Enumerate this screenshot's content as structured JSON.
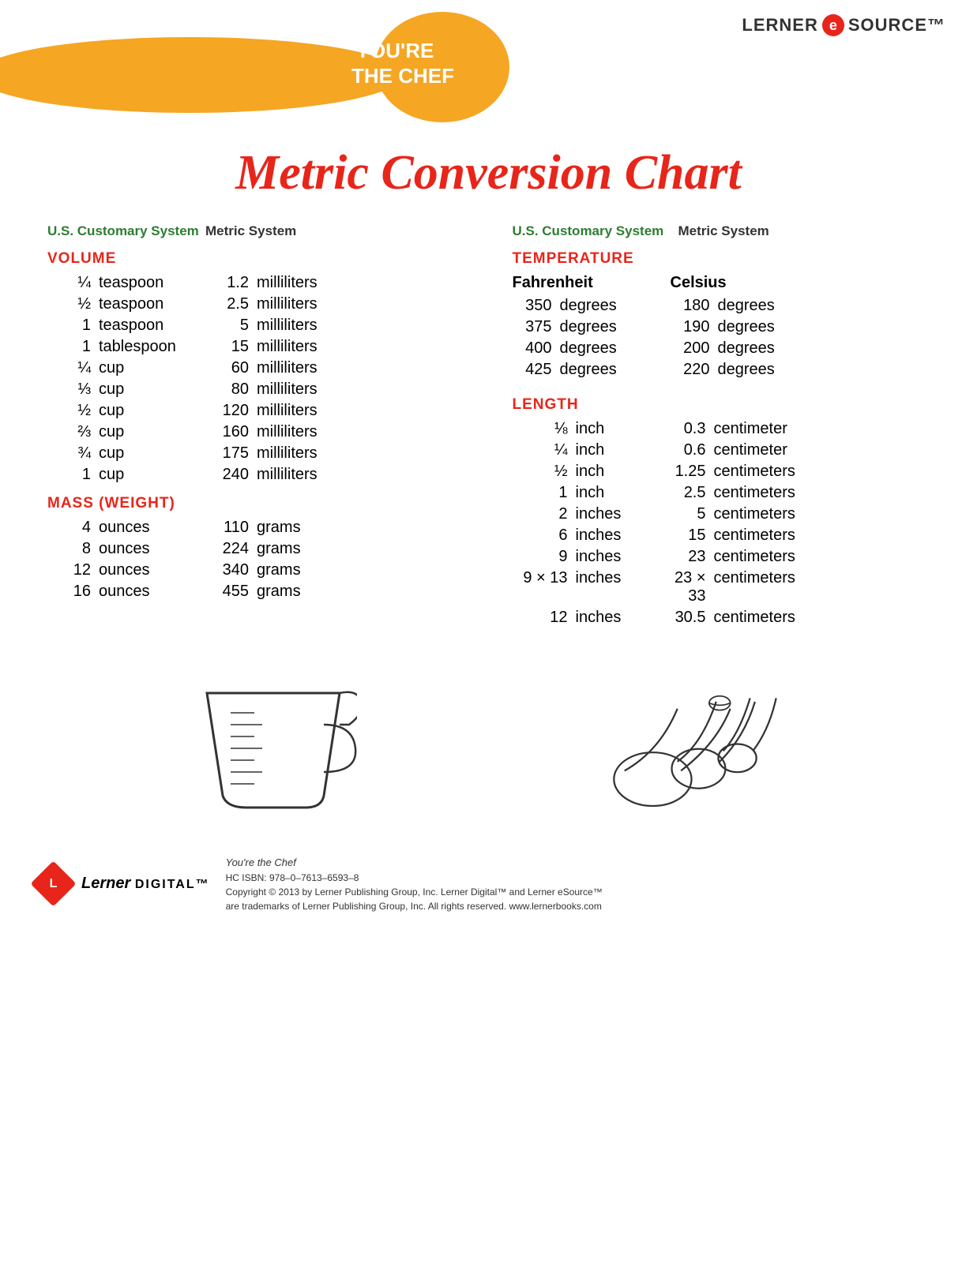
{
  "header": {
    "spoon_text_line1": "YOU'RE",
    "spoon_text_line2": "THE CHEF",
    "lerner_text1": "LERNER",
    "lerner_e": "e",
    "lerner_text2": "SOURCE™"
  },
  "title": "Metric Conversion Chart",
  "left_column": {
    "us_header": "U.S. Customary System",
    "metric_header": "Metric System",
    "volume": {
      "label": "VOLUME",
      "rows": [
        {
          "us_amount": "¼",
          "us_unit": "teaspoon",
          "metric_amount": "1.2",
          "metric_unit": "milliliters"
        },
        {
          "us_amount": "½",
          "us_unit": "teaspoon",
          "metric_amount": "2.5",
          "metric_unit": "milliliters"
        },
        {
          "us_amount": "1",
          "us_unit": "teaspoon",
          "metric_amount": "5",
          "metric_unit": "milliliters"
        },
        {
          "us_amount": "1",
          "us_unit": "tablespoon",
          "metric_amount": "15",
          "metric_unit": "milliliters"
        },
        {
          "us_amount": "¼",
          "us_unit": "cup",
          "metric_amount": "60",
          "metric_unit": "milliliters"
        },
        {
          "us_amount": "⅓",
          "us_unit": "cup",
          "metric_amount": "80",
          "metric_unit": "milliliters"
        },
        {
          "us_amount": "½",
          "us_unit": "cup",
          "metric_amount": "120",
          "metric_unit": "milliliters"
        },
        {
          "us_amount": "⅔",
          "us_unit": "cup",
          "metric_amount": "160",
          "metric_unit": "milliliters"
        },
        {
          "us_amount": "¾",
          "us_unit": "cup",
          "metric_amount": "175",
          "metric_unit": "milliliters"
        },
        {
          "us_amount": "1",
          "us_unit": "cup",
          "metric_amount": "240",
          "metric_unit": "milliliters"
        }
      ]
    },
    "mass": {
      "label": "MASS (WEIGHT)",
      "rows": [
        {
          "us_amount": "4",
          "us_unit": "ounces",
          "metric_amount": "110",
          "metric_unit": "grams"
        },
        {
          "us_amount": "8",
          "us_unit": "ounces",
          "metric_amount": "224",
          "metric_unit": "grams"
        },
        {
          "us_amount": "12",
          "us_unit": "ounces",
          "metric_amount": "340",
          "metric_unit": "grams"
        },
        {
          "us_amount": "16",
          "us_unit": "ounces",
          "metric_amount": "455",
          "metric_unit": "grams"
        }
      ]
    }
  },
  "right_column": {
    "us_header": "U.S. Customary System",
    "metric_header": "Metric System",
    "temperature": {
      "label": "TEMPERATURE",
      "fahrenheit_header": "Fahrenheit",
      "celsius_header": "Celsius",
      "rows": [
        {
          "f_amount": "350",
          "f_unit": "degrees",
          "c_amount": "180",
          "c_unit": "degrees"
        },
        {
          "f_amount": "375",
          "f_unit": "degrees",
          "c_amount": "190",
          "c_unit": "degrees"
        },
        {
          "f_amount": "400",
          "f_unit": "degrees",
          "c_amount": "200",
          "c_unit": "degrees"
        },
        {
          "f_amount": "425",
          "f_unit": "degrees",
          "c_amount": "220",
          "c_unit": "degrees"
        }
      ]
    },
    "length": {
      "label": "LENGTH",
      "rows": [
        {
          "us_amount": "⅛",
          "us_unit": "inch",
          "metric_amount": "0.3",
          "metric_unit": "centimeter"
        },
        {
          "us_amount": "¼",
          "us_unit": "inch",
          "metric_amount": "0.6",
          "metric_unit": "centimeter"
        },
        {
          "us_amount": "½",
          "us_unit": "inch",
          "metric_amount": "1.25",
          "metric_unit": "centimeters"
        },
        {
          "us_amount": "1",
          "us_unit": "inch",
          "metric_amount": "2.5",
          "metric_unit": "centimeters"
        },
        {
          "us_amount": "2",
          "us_unit": "inches",
          "metric_amount": "5",
          "metric_unit": "centimeters"
        },
        {
          "us_amount": "6",
          "us_unit": "inches",
          "metric_amount": "15",
          "metric_unit": "centimeters"
        },
        {
          "us_amount": "9",
          "us_unit": "inches",
          "metric_amount": "23",
          "metric_unit": "centimeters"
        },
        {
          "us_amount": "9 × 13",
          "us_unit": "inches",
          "metric_amount": "23 × 33",
          "metric_unit": "centimeters"
        },
        {
          "us_amount": "12",
          "us_unit": "inches",
          "metric_amount": "30.5",
          "metric_unit": "centimeters"
        }
      ]
    }
  },
  "footer": {
    "book_title": "You're the Chef",
    "isbn": "HC ISBN: 978–0–7613–6593–8",
    "copyright": "Copyright © 2013 by Lerner Publishing Group, Inc. Lerner Digital™ and Lerner eSource™",
    "trademark": "are trademarks of Lerner Publishing Group, Inc. All rights reserved. www.lernerbooks.com",
    "lerner_digital": "Lerner DIGITAL™"
  }
}
